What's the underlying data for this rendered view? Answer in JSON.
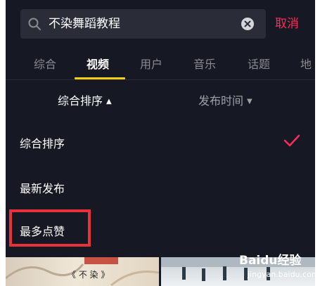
{
  "search": {
    "query": "不染舞蹈教程",
    "cancel_label": "取消"
  },
  "tabs": [
    {
      "label": "综合"
    },
    {
      "label": "视频"
    },
    {
      "label": "用户"
    },
    {
      "label": "音乐"
    },
    {
      "label": "话题"
    },
    {
      "label": "地"
    }
  ],
  "active_tab": "视频",
  "sort_bar": {
    "primary": "综合排序",
    "secondary": "发布时间"
  },
  "sort_options": [
    {
      "label": "综合排序",
      "selected": true
    },
    {
      "label": "最新发布",
      "selected": false
    },
    {
      "label": "最多点赞",
      "selected": false
    }
  ],
  "thumbnails": {
    "left_title": "《 不 染 》"
  },
  "watermark": {
    "brand": "Baidu经验",
    "url": "jingyan.baidu.com"
  },
  "colors": {
    "background": "#161823",
    "accent": "#fe2c55",
    "tab_indicator": "#face15",
    "highlight": "#e8323a"
  }
}
